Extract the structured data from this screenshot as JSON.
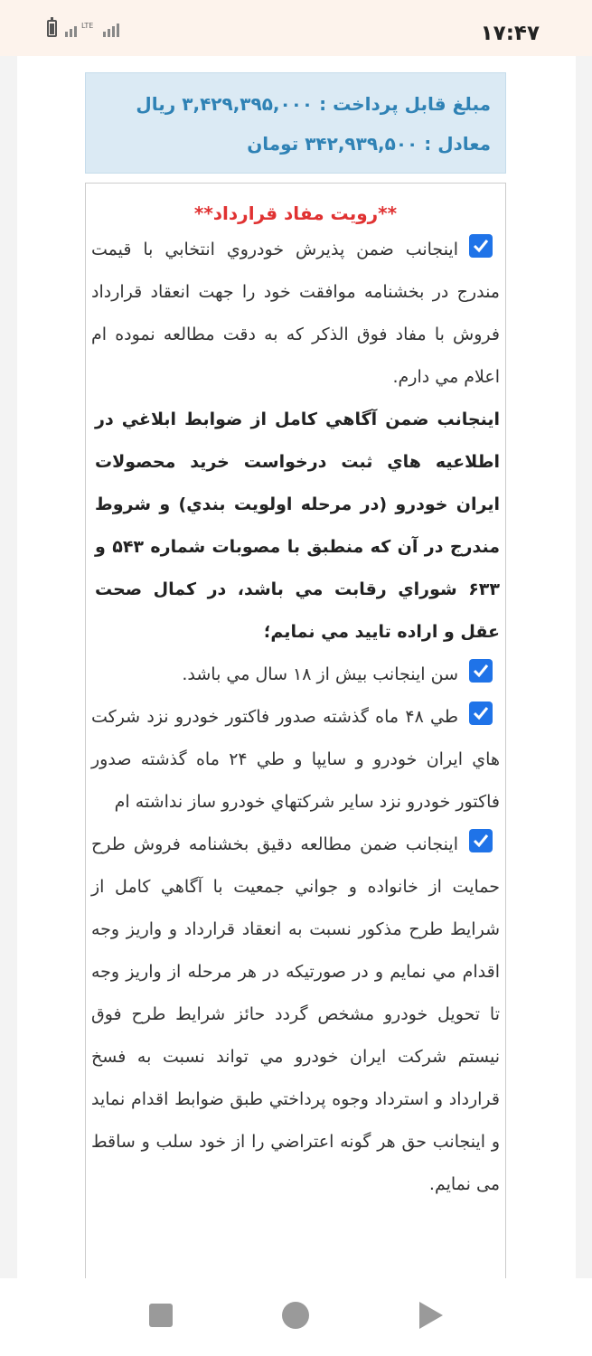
{
  "status_bar": {
    "time": "۱۷:۴۷",
    "network_label": "LTE",
    "icons": [
      "battery-icon",
      "signal-icon"
    ]
  },
  "payment": {
    "amount_line": "مبلغ قابل پرداخت : ۳,۴۲۹,۳۹۵,۰۰۰ ریال",
    "equivalent_line": "معادل : ۳۴۲,۹۳۹,۵۰۰ تومان",
    "text_color": "#2f82b5",
    "background": "#dbeaf4"
  },
  "contract": {
    "title": "**رويت مفاد قرارداد**",
    "title_color": "#e03232",
    "clause_1": {
      "checked": true,
      "text": "اينجانب ضمن پذيرش خودروي انتخابي با قيمت مندرج در بخشنامه موافقت خود را جهت انعقاد قرارداد فروش با مفاد فوق الذكر كه به دقت مطالعه نموده ام اعلام مي دارم."
    },
    "bold_notice": "اينجانب ضمن آگاهي كامل از ضوابط ابلاغي در اطلاعيه هاي ثبت درخواست خريد محصولات ايران خودرو (در مرحله اولويت بندي) و شروط مندرج در آن كه منطبق با مصوبات شماره ۵۴۳ و ۶۳۳ شوراي رقابت مي باشد، در كمال صحت عقل و اراده تاييد مي نمايم؛",
    "clause_2": {
      "checked": true,
      "text": "سن اينجانب بيش از ۱۸ سال مي باشد."
    },
    "clause_3": {
      "checked": true,
      "text": "طي ۴۸ ماه گذشته صدور فاكتور خودرو نزد شركت هاي ايران خودرو و سايپا و طي ۲۴ ماه گذشته صدور فاكتور خودرو نزد ساير شركتهاي خودرو ساز نداشته ام"
    },
    "clause_4": {
      "checked": true,
      "text": "اينجانب ضمن مطالعه دقيق بخشنامه فروش طرح حمايت از خانواده و جواني جمعيت با آگاهي كامل از شرايط طرح مذكور نسبت به انعقاد قرارداد و واريز وجه اقدام مي نمايم و در صورتيكه در هر مرحله از واريز وجه تا تحويل خودرو مشخص گردد حائز شرايط طرح فوق نيستم شركت ايران خودرو مي تواند نسبت به فسخ قرارداد و استرداد وجوه پرداختي طبق ضوابط اقدام نمايد و اينجانب حق هر گونه اعتراضي را از خود سلب و ساقط می نمايم."
    },
    "checkbox_color": "#1f73e8"
  },
  "nav_bar": {
    "buttons": [
      "recents-square-icon",
      "home-circle-icon",
      "back-triangle-icon"
    ]
  }
}
